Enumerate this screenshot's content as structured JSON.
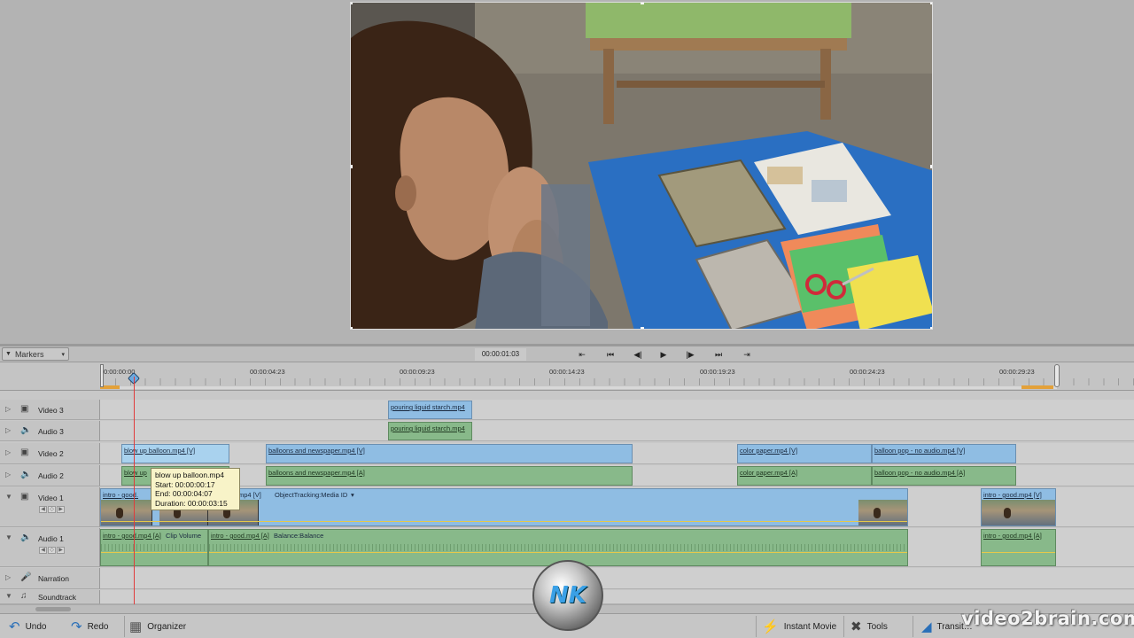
{
  "transport": {
    "markers_label": "Markers",
    "timecode": "00:00:01:03"
  },
  "ruler": {
    "labels": [
      "0:00:00:00",
      "00:00:04:23",
      "00:00:09:23",
      "00:00:14:23",
      "00:00:19:23",
      "00:00:24:23",
      "00:00:29:23"
    ]
  },
  "tracks": {
    "video3": "Video 3",
    "audio3": "Audio 3",
    "video2": "Video 2",
    "audio2": "Audio 2",
    "video1": "Video 1",
    "audio1": "Audio 1",
    "narration": "Narration",
    "soundtrack": "Soundtrack"
  },
  "clips": {
    "v3_pouring": "pouring liquid starch.mp4",
    "a3_pouring": "pouring liquid starch.mp4",
    "v2_balloon": "blow up balloon.mp4 [V]",
    "a2_balloon": "blow up",
    "v2_newspaper": "balloons and newspaper.mp4 [V]",
    "a2_newspaper": "balloons and newspaper.mp4 [A]",
    "v2_color": "color paper.mp4 [V]",
    "a2_color": "color paper.mp4 [A]",
    "v2_pop": "balloon pop - no audio.mp4 [V]",
    "a2_pop": "balloon pop - no audio.mp4 [A]",
    "v1_intro_a": "intro - good.",
    "v1_intro_b": "mp4 [V]",
    "v1_effect": "ObjectTracking:Media ID",
    "v1_intro_end": "intro - good.mp4 [V]",
    "a1_intro_a": "intro - good.mp4 [A]",
    "a1_clipvol": "Clip Volume",
    "a1_intro_b": "intro - good.mp4 [A]",
    "a1_balance": "Balance:Balance",
    "a1_intro_end": "intro - good.mp4 [A]"
  },
  "tooltip": {
    "name": "blow up balloon.mp4",
    "start": "Start: 00:00:00:17",
    "end": "End: 00:00:04:07",
    "duration": "Duration: 00:00:03:15"
  },
  "bottom": {
    "undo": "Undo",
    "redo": "Redo",
    "organizer": "Organizer",
    "instant_movie": "Instant Movie",
    "tools": "Tools",
    "transitions": "Transit…",
    "brand": "video2brain.com"
  },
  "colors": {
    "video_clip": "#8fbde3",
    "audio_clip": "#88b98a",
    "playhead": "#e03b3b",
    "tooltip_bg": "#f8f3c8",
    "accent": "#2a6fb8"
  }
}
